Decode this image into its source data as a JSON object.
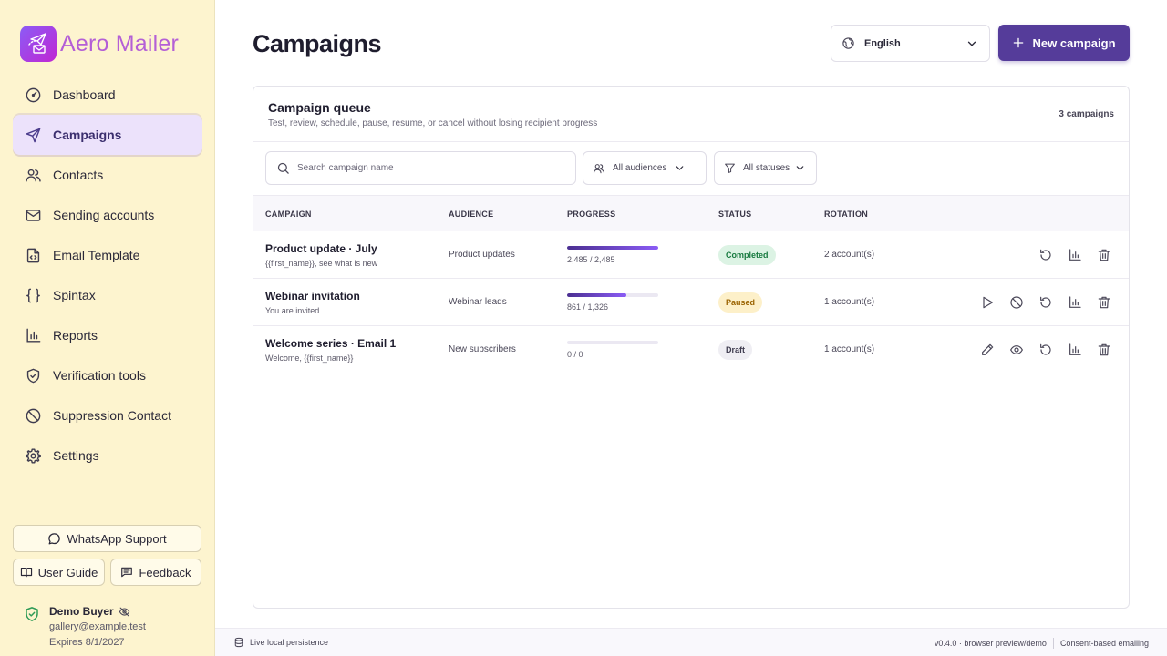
{
  "brand": {
    "name": "Aero Mailer"
  },
  "sidebar": {
    "items": [
      {
        "label": "Dashboard",
        "icon": "dashboard-gauge-icon",
        "active": false
      },
      {
        "label": "Campaigns",
        "icon": "send-icon",
        "active": true
      },
      {
        "label": "Contacts",
        "icon": "users-icon",
        "active": false
      },
      {
        "label": "Sending accounts",
        "icon": "mail-icon",
        "active": false
      },
      {
        "label": "Email Template",
        "icon": "file-code-icon",
        "active": false
      },
      {
        "label": "Spintax",
        "icon": "braces-icon",
        "active": false
      },
      {
        "label": "Reports",
        "icon": "bar-chart-icon",
        "active": false
      },
      {
        "label": "Verification tools",
        "icon": "shield-check-icon",
        "active": false
      },
      {
        "label": "Suppression Contact",
        "icon": "ban-icon",
        "active": false
      },
      {
        "label": "Settings",
        "icon": "gear-icon",
        "active": false
      }
    ],
    "whatsapp_label": "WhatsApp Support",
    "guide_label": "User Guide",
    "feedback_label": "Feedback",
    "user": {
      "name": "Demo Buyer",
      "email": "gallery@example.test",
      "expires": "Expires 8/1/2027"
    }
  },
  "header": {
    "title": "Campaigns",
    "language": "English",
    "new_campaign_label": "New campaign"
  },
  "queue": {
    "title": "Campaign queue",
    "subtitle": "Test, review, schedule, pause, resume, or cancel without losing recipient progress",
    "count": "3 campaigns",
    "search_placeholder": "Search campaign name",
    "audience_filter": "All audiences",
    "status_filter": "All statuses",
    "columns": {
      "campaign": "CAMPAIGN",
      "audience": "AUDIENCE",
      "progress": "PROGRESS",
      "status": "STATUS",
      "rotation": "ROTATION"
    },
    "rows": [
      {
        "name": "Product update · July",
        "subject": "{{first_name}}, see what is new",
        "audience": "Product updates",
        "progress": "2,485 / 2,485",
        "progress_fraction": 1.0,
        "status": "Completed",
        "rotation": "2 account(s)",
        "actions": [
          "restart-icon",
          "bar-chart-icon",
          "trash-icon"
        ]
      },
      {
        "name": "Webinar invitation",
        "subject": "You are invited",
        "audience": "Webinar leads",
        "progress": "861 / 1,326",
        "progress_fraction": 0.649,
        "status": "Paused",
        "rotation": "1 account(s)",
        "actions": [
          "play-icon",
          "ban-icon",
          "restart-icon",
          "bar-chart-icon",
          "trash-icon"
        ]
      },
      {
        "name": "Welcome series · Email 1",
        "subject": "Welcome, {{first_name}}",
        "audience": "New subscribers",
        "progress": "0 / 0",
        "progress_fraction": 0,
        "status": "Draft",
        "rotation": "1 account(s)",
        "actions": [
          "pencil-icon",
          "eye-icon",
          "restart-icon",
          "bar-chart-icon",
          "trash-icon"
        ]
      }
    ]
  },
  "footer": {
    "persistence": "Live local persistence",
    "version": "v0.4.0 · browser preview/demo",
    "consent": "Consent-based emailing"
  },
  "colors": {
    "accent": "#553c9a",
    "sidebar_bg": "#fdf4cf",
    "brand": "#b45fd6"
  }
}
